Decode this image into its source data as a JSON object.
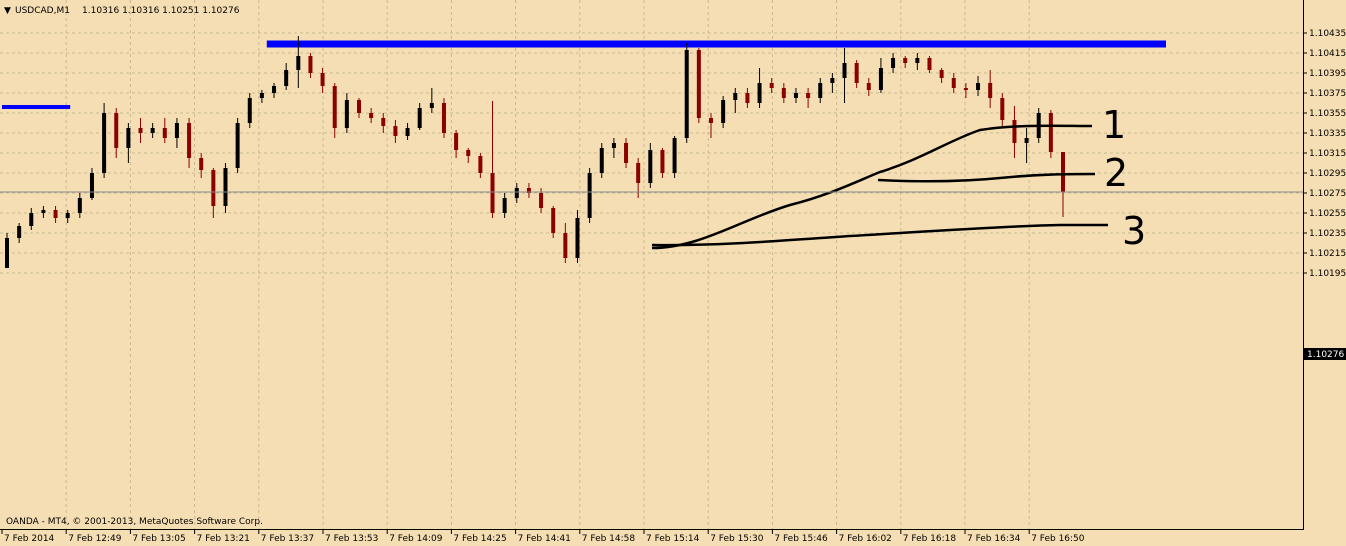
{
  "header": {
    "symbol_label": "USDCAD,M1",
    "ohlc": "1.10316 1.10316 1.10251 1.10276"
  },
  "copyright": "OANDA - MT4, © 2001-2013, MetaQuotes Software Corp.",
  "colors": {
    "background": "#f5deb3",
    "grid": "#c8b991",
    "bull_body": "#000000",
    "bear_body": "#8b0000",
    "level_line": "#0000ff",
    "drawing": "#000000"
  },
  "chart_data": {
    "type": "candlestick",
    "symbol": "USDCAD",
    "timeframe": "M1",
    "grid": true,
    "ylim": [
      1.10185,
      1.10465
    ],
    "y_ticks": [
      "1.10435",
      "1.10415",
      "1.10395",
      "1.10375",
      "1.10355",
      "1.10335",
      "1.10315",
      "1.10295",
      "1.10275",
      "1.10255",
      "1.10235",
      "1.10215",
      "1.10195"
    ],
    "x_ticks": [
      "7 Feb 2014",
      "7 Feb 12:49",
      "7 Feb 13:05",
      "7 Feb 13:21",
      "7 Feb 13:37",
      "7 Feb 13:53",
      "7 Feb 14:09",
      "7 Feb 14:25",
      "7 Feb 14:41",
      "7 Feb 14:58",
      "7 Feb 15:14",
      "7 Feb 15:30",
      "7 Feb 15:46",
      "7 Feb 16:02",
      "7 Feb 16:18",
      "7 Feb 16:34",
      "7 Feb 16:50"
    ],
    "current_price": "1.10276",
    "horizontal_levels": [
      {
        "name": "resistance",
        "price": 1.10424,
        "from": "7 Feb 13:37",
        "to": "end"
      },
      {
        "name": "prior level",
        "price": 1.10361,
        "from": "start",
        "to": "7 Feb 12:49"
      }
    ],
    "annotations": [
      "1",
      "2",
      "3"
    ],
    "candles_ohlc": [
      [
        1.102,
        1.10235,
        1.102,
        1.1023
      ],
      [
        1.1023,
        1.10245,
        1.10225,
        1.10242
      ],
      [
        1.10242,
        1.1026,
        1.10238,
        1.10255
      ],
      [
        1.10255,
        1.10262,
        1.1025,
        1.10258
      ],
      [
        1.10258,
        1.10262,
        1.10245,
        1.1025
      ],
      [
        1.1025,
        1.10258,
        1.10245,
        1.10255
      ],
      [
        1.10255,
        1.10275,
        1.1025,
        1.1027
      ],
      [
        1.1027,
        1.103,
        1.10268,
        1.10295
      ],
      [
        1.10295,
        1.10365,
        1.1029,
        1.10355
      ],
      [
        1.10355,
        1.1036,
        1.1031,
        1.1032
      ],
      [
        1.1032,
        1.10345,
        1.10305,
        1.1034
      ],
      [
        1.1034,
        1.1035,
        1.10325,
        1.10335
      ],
      [
        1.10335,
        1.10345,
        1.1033,
        1.1034
      ],
      [
        1.1034,
        1.1035,
        1.10325,
        1.1033
      ],
      [
        1.1033,
        1.1035,
        1.1032,
        1.10345
      ],
      [
        1.10345,
        1.1035,
        1.103,
        1.1031
      ],
      [
        1.1031,
        1.10315,
        1.1029,
        1.10298
      ],
      [
        1.10298,
        1.103,
        1.1025,
        1.10262
      ],
      [
        1.10262,
        1.10305,
        1.10255,
        1.103
      ],
      [
        1.103,
        1.1035,
        1.10295,
        1.10345
      ],
      [
        1.10345,
        1.10375,
        1.1034,
        1.1037
      ],
      [
        1.1037,
        1.10378,
        1.10365,
        1.10375
      ],
      [
        1.10375,
        1.10385,
        1.1037,
        1.10382
      ],
      [
        1.10382,
        1.10405,
        1.10378,
        1.10398
      ],
      [
        1.10398,
        1.10432,
        1.1038,
        1.10412
      ],
      [
        1.10412,
        1.10415,
        1.1039,
        1.10395
      ],
      [
        1.10395,
        1.104,
        1.10375,
        1.10382
      ],
      [
        1.10382,
        1.10385,
        1.1033,
        1.1034
      ],
      [
        1.1034,
        1.10375,
        1.10335,
        1.10368
      ],
      [
        1.10368,
        1.1037,
        1.1035,
        1.10355
      ],
      [
        1.10355,
        1.1036,
        1.10345,
        1.1035
      ],
      [
        1.1035,
        1.10355,
        1.10335,
        1.10342
      ],
      [
        1.10342,
        1.10348,
        1.10325,
        1.10332
      ],
      [
        1.10332,
        1.10345,
        1.10328,
        1.1034
      ],
      [
        1.1034,
        1.10365,
        1.10338,
        1.1036
      ],
      [
        1.1036,
        1.1038,
        1.10355,
        1.10365
      ],
      [
        1.10365,
        1.1037,
        1.1033,
        1.10335
      ],
      [
        1.10335,
        1.10338,
        1.1031,
        1.10318
      ],
      [
        1.10318,
        1.1032,
        1.10305,
        1.10312
      ],
      [
        1.10312,
        1.10315,
        1.1029,
        1.10295
      ],
      [
        1.10295,
        1.10367,
        1.1025,
        1.10255
      ],
      [
        1.10255,
        1.10275,
        1.1025,
        1.1027
      ],
      [
        1.1027,
        1.10285,
        1.10265,
        1.1028
      ],
      [
        1.1028,
        1.10285,
        1.1027,
        1.10275
      ],
      [
        1.10275,
        1.1028,
        1.10255,
        1.1026
      ],
      [
        1.1026,
        1.10262,
        1.1023,
        1.10235
      ],
      [
        1.10235,
        1.10245,
        1.10205,
        1.1021
      ],
      [
        1.1021,
        1.10258,
        1.10205,
        1.1025
      ],
      [
        1.1025,
        1.103,
        1.10245,
        1.10295
      ],
      [
        1.10295,
        1.10325,
        1.1029,
        1.1032
      ],
      [
        1.1032,
        1.1033,
        1.1031,
        1.10325
      ],
      [
        1.10325,
        1.1033,
        1.103,
        1.10305
      ],
      [
        1.10305,
        1.1031,
        1.1027,
        1.10285
      ],
      [
        1.10285,
        1.10325,
        1.1028,
        1.10318
      ],
      [
        1.10318,
        1.1032,
        1.1029,
        1.10295
      ],
      [
        1.10295,
        1.10332,
        1.1029,
        1.1033
      ],
      [
        1.1033,
        1.10425,
        1.10325,
        1.10418
      ],
      [
        1.10418,
        1.1042,
        1.10345,
        1.1035
      ],
      [
        1.1035,
        1.10355,
        1.1033,
        1.10345
      ],
      [
        1.10345,
        1.10372,
        1.1034,
        1.10368
      ],
      [
        1.10368,
        1.1038,
        1.10355,
        1.10375
      ],
      [
        1.10375,
        1.1038,
        1.1036,
        1.10365
      ],
      [
        1.10365,
        1.104,
        1.1036,
        1.10385
      ],
      [
        1.10385,
        1.1039,
        1.10375,
        1.1038
      ],
      [
        1.1038,
        1.10385,
        1.10365,
        1.1037
      ],
      [
        1.1037,
        1.1038,
        1.10365,
        1.10375
      ],
      [
        1.10375,
        1.1038,
        1.1036,
        1.1037
      ],
      [
        1.1037,
        1.1039,
        1.10365,
        1.10385
      ],
      [
        1.10385,
        1.10395,
        1.10375,
        1.1039
      ],
      [
        1.1039,
        1.1042,
        1.10365,
        1.10405
      ],
      [
        1.10405,
        1.10408,
        1.1038,
        1.10385
      ],
      [
        1.10385,
        1.1039,
        1.10372,
        1.10378
      ],
      [
        1.10378,
        1.1041,
        1.10375,
        1.104
      ],
      [
        1.104,
        1.10415,
        1.10395,
        1.1041
      ],
      [
        1.1041,
        1.10412,
        1.104,
        1.10405
      ],
      [
        1.10405,
        1.10415,
        1.10398,
        1.1041
      ],
      [
        1.1041,
        1.10412,
        1.10395,
        1.10398
      ],
      [
        1.10398,
        1.104,
        1.10385,
        1.1039
      ],
      [
        1.1039,
        1.10395,
        1.10375,
        1.1038
      ],
      [
        1.1038,
        1.10385,
        1.1037,
        1.10378
      ],
      [
        1.10378,
        1.10392,
        1.10372,
        1.10385
      ],
      [
        1.10385,
        1.10398,
        1.1036,
        1.1037
      ],
      [
        1.1037,
        1.10375,
        1.1034,
        1.10348
      ],
      [
        1.10348,
        1.10362,
        1.1031,
        1.10325
      ],
      [
        1.10325,
        1.1034,
        1.10305,
        1.1033
      ],
      [
        1.1033,
        1.1036,
        1.10325,
        1.10355
      ],
      [
        1.10355,
        1.10358,
        1.1031,
        1.10316
      ],
      [
        1.10316,
        1.10316,
        1.10251,
        1.10276
      ]
    ]
  }
}
